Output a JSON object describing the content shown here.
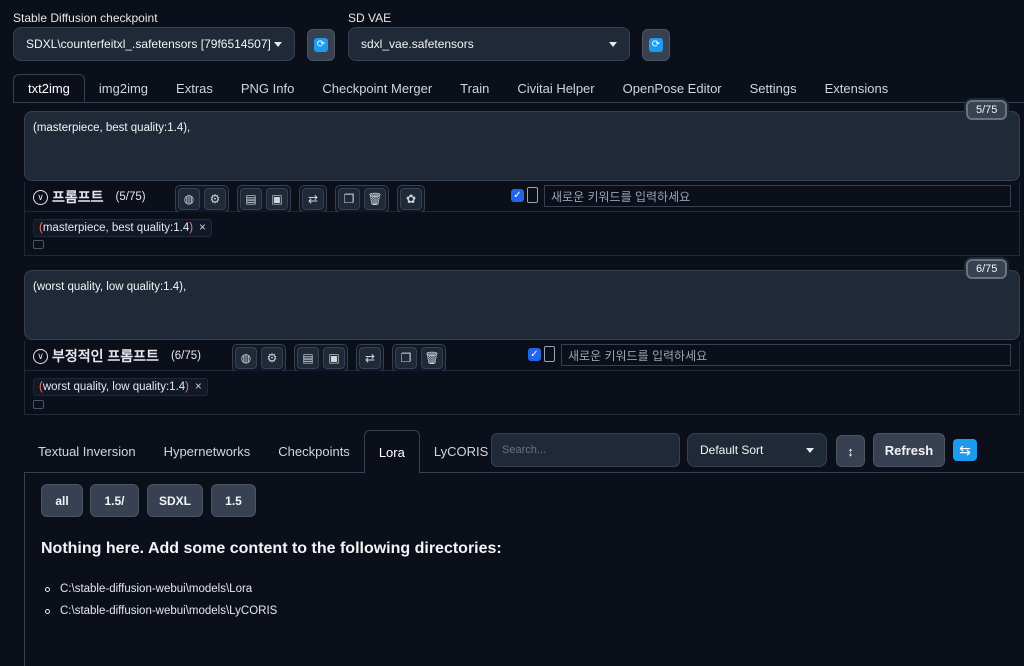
{
  "checkpoint": {
    "label": "Stable Diffusion checkpoint",
    "value": "SDXL\\counterfeitxl_.safetensors [79f6514507]"
  },
  "vae": {
    "label": "SD VAE",
    "value": "sdxl_vae.safetensors"
  },
  "tabs": [
    "txt2img",
    "img2img",
    "Extras",
    "PNG Info",
    "Checkpoint Merger",
    "Train",
    "Civitai Helper",
    "OpenPose Editor",
    "Settings",
    "Extensions"
  ],
  "prompt": {
    "text": "(masterpiece, best quality:1.4),",
    "counter": "5/75",
    "title": "프롬프트",
    "count": "(5/75)",
    "keyword_placeholder": "새로운 키워드를 입력하세요",
    "chip_text": "masterpiece, best quality:1.4",
    "chip_open": "(",
    "chip_close": ")",
    "chip_remove": "×"
  },
  "negative": {
    "text": "(worst quality, low quality:1.4),",
    "counter": "6/75",
    "title": "부정적인 프롬프트",
    "count": "(6/75)",
    "keyword_placeholder": "새로운 키워드를 입력하세요",
    "chip_text": "worst quality, low quality:1.4",
    "chip_open": "(",
    "chip_close": ")",
    "chip_remove": "×"
  },
  "network_tabs": [
    "Textual Inversion",
    "Hypernetworks",
    "Checkpoints",
    "Lora",
    "LyCORIS"
  ],
  "search_placeholder": "Search...",
  "sort_value": "Default Sort",
  "sort_dir_icon": "↕",
  "refresh_label": "Refresh",
  "filters": [
    "all",
    "1.5/",
    "SDXL",
    "1.5"
  ],
  "empty": {
    "heading": "Nothing here. Add some content to the following directories:",
    "dirs": [
      "C:\\stable-diffusion-webui\\models\\Lora",
      "C:\\stable-diffusion-webui\\models\\LyCORIS"
    ]
  },
  "colors": {
    "accent": "#2563eb",
    "refresh_icon": "#1d9bf0",
    "bg": "#0b0f19",
    "paren": "#f87171"
  },
  "icons": [
    "globe-icon",
    "gear-icon",
    "clipboard-icon",
    "bookmark-icon",
    "translate-icon",
    "copy-icon",
    "trash-icon",
    "openai-icon",
    "expand-icon",
    "refresh-icon"
  ]
}
